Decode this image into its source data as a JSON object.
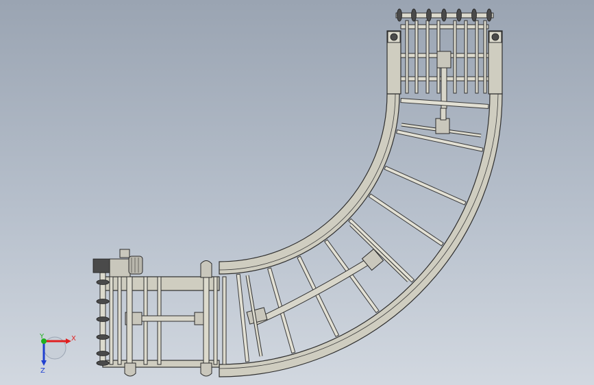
{
  "viewport": {
    "background_top": "#9aa4b2",
    "background_bottom": "#d2d8e0"
  },
  "model": {
    "frame_color": "#cfcdc0",
    "line_color": "#2e2e2e"
  },
  "triad": {
    "x_label": "X",
    "y_label": "Y",
    "z_label": "Z",
    "x_color": "#e02020",
    "y_color": "#20b020",
    "z_color": "#2040d0"
  }
}
